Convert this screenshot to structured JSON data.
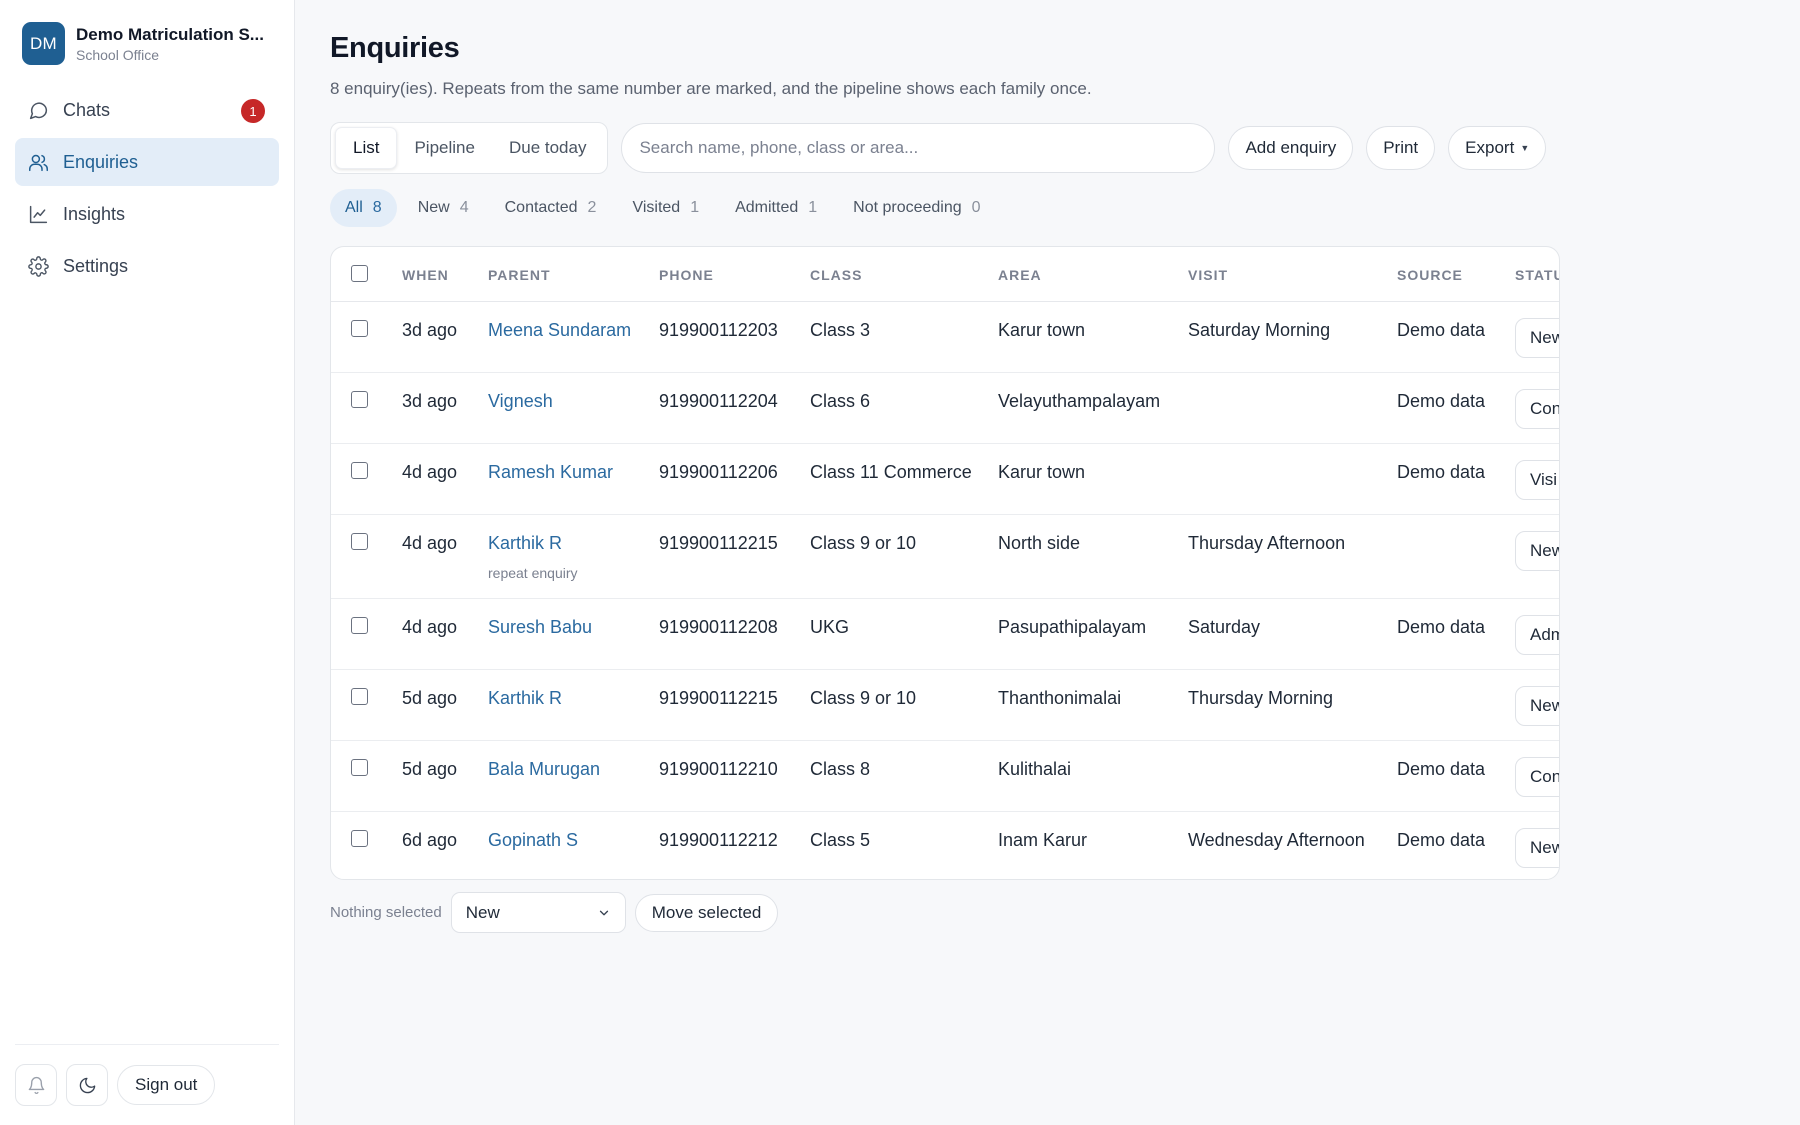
{
  "sidebar": {
    "avatar_initials": "DM",
    "org_name": "Demo Matriculation S...",
    "org_sub": "School Office",
    "nav": [
      {
        "label": "Chats",
        "icon": "chat-bubble-icon",
        "badge": "1"
      },
      {
        "label": "Enquiries",
        "icon": "users-icon",
        "active": true
      },
      {
        "label": "Insights",
        "icon": "line-chart-icon"
      },
      {
        "label": "Settings",
        "icon": "gear-icon"
      }
    ],
    "footer": {
      "signout_label": "Sign out"
    }
  },
  "main": {
    "title": "Enquiries",
    "subtitle": "8 enquiry(ies). Repeats from the same number are marked, and the pipeline shows each family once.",
    "views": [
      "List",
      "Pipeline",
      "Due today"
    ],
    "active_view": "List",
    "search_placeholder": "Search name, phone, class or area...",
    "actions": {
      "add": "Add enquiry",
      "print": "Print",
      "export": "Export"
    },
    "filters": [
      {
        "label": "All",
        "count": "8"
      },
      {
        "label": "New",
        "count": "4"
      },
      {
        "label": "Contacted",
        "count": "2"
      },
      {
        "label": "Visited",
        "count": "1"
      },
      {
        "label": "Admitted",
        "count": "1"
      },
      {
        "label": "Not proceeding",
        "count": "0"
      }
    ]
  },
  "table": {
    "columns": [
      "WHEN",
      "PARENT",
      "PHONE",
      "CLASS",
      "AREA",
      "VISIT",
      "SOURCE",
      "STATU"
    ],
    "rows": [
      {
        "when": "3d ago",
        "parent": "Meena Sundaram",
        "phone": "919900112203",
        "class": "Class 3",
        "area": "Karur town",
        "visit": "Saturday Morning",
        "source": "Demo data",
        "status": "New"
      },
      {
        "when": "3d ago",
        "parent": "Vignesh",
        "phone": "919900112204",
        "class": "Class 6",
        "area": "Velayuthampalayam",
        "visit": "",
        "source": "Demo data",
        "status": "Con"
      },
      {
        "when": "4d ago",
        "parent": "Ramesh Kumar",
        "phone": "919900112206",
        "class": "Class 11 Commerce",
        "area": "Karur town",
        "visit": "",
        "source": "Demo data",
        "status": "Visi"
      },
      {
        "when": "4d ago",
        "parent": "Karthik R",
        "note": "repeat enquiry",
        "phone": "919900112215",
        "class": "Class 9 or 10",
        "area": "North side",
        "visit": "Thursday Afternoon",
        "source": "",
        "status": "New"
      },
      {
        "when": "4d ago",
        "parent": "Suresh Babu",
        "phone": "919900112208",
        "class": "UKG",
        "area": "Pasupathipalayam",
        "visit": "Saturday",
        "source": "Demo data",
        "status": "Adm"
      },
      {
        "when": "5d ago",
        "parent": "Karthik R",
        "phone": "919900112215",
        "class": "Class 9 or 10",
        "area": "Thanthonimalai",
        "visit": "Thursday Morning",
        "source": "",
        "status": "New"
      },
      {
        "when": "5d ago",
        "parent": "Bala Murugan",
        "phone": "919900112210",
        "class": "Class 8",
        "area": "Kulithalai",
        "visit": "",
        "source": "Demo data",
        "status": "Con"
      },
      {
        "when": "6d ago",
        "parent": "Gopinath S",
        "phone": "919900112212",
        "class": "Class 5",
        "area": "Inam Karur",
        "visit": "Wednesday Afternoon",
        "source": "Demo data",
        "status": "New"
      }
    ]
  },
  "bulk": {
    "label": "Nothing selected",
    "select_value": "New",
    "move_label": "Move selected"
  },
  "colors": {
    "accent": "#1f5f92",
    "link": "#2b6aa0",
    "badge": "#c62828",
    "active_bg": "#e3edf8"
  }
}
